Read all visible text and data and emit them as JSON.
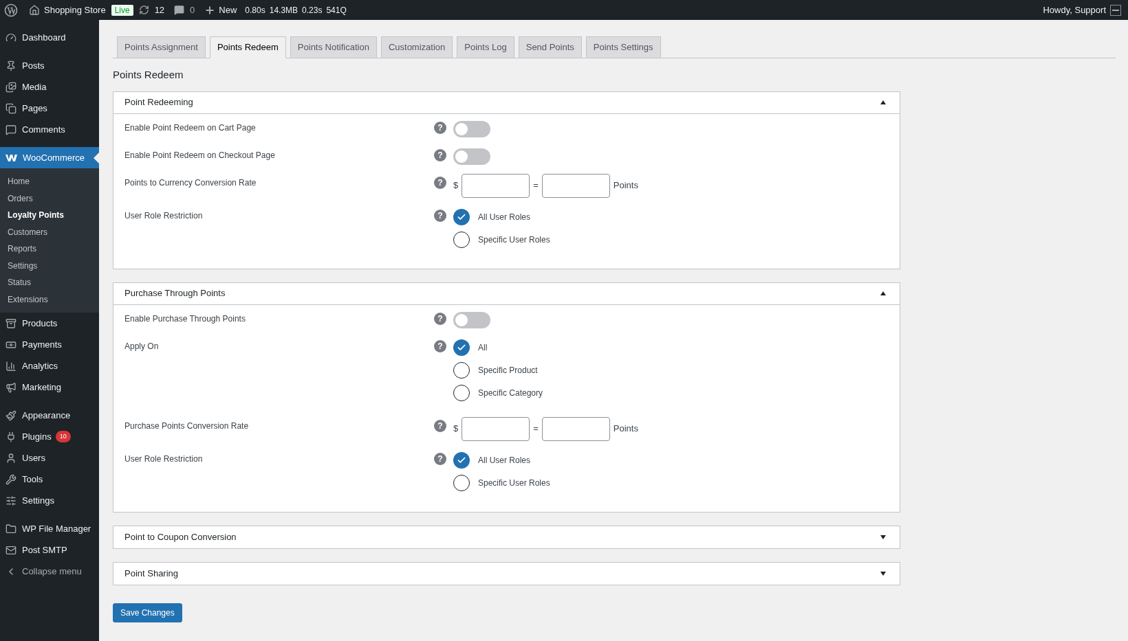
{
  "admin_bar": {
    "site": "Shopping Store",
    "live_badge": "Live",
    "updates": "12",
    "comments": "0",
    "new": "New",
    "stats": [
      "0.80s",
      "14.3MB",
      "0.23s",
      "541Q"
    ],
    "greeting": "Howdy, Support"
  },
  "sidebar": {
    "groups": [
      [
        {
          "label": "Dashboard",
          "selected": false
        }
      ],
      [
        {
          "label": "Posts",
          "selected": false
        },
        {
          "label": "Media",
          "selected": false
        },
        {
          "label": "Pages",
          "selected": false
        },
        {
          "label": "Comments",
          "selected": false
        }
      ],
      [
        {
          "label": "WooCommerce",
          "selected": true,
          "children": [
            {
              "label": "Home",
              "selected": false
            },
            {
              "label": "Orders",
              "selected": false
            },
            {
              "label": "Loyalty Points",
              "selected": true
            },
            {
              "label": "Customers",
              "selected": false
            },
            {
              "label": "Reports",
              "selected": false
            },
            {
              "label": "Settings",
              "selected": false
            },
            {
              "label": "Status",
              "selected": false
            },
            {
              "label": "Extensions",
              "selected": false
            }
          ]
        },
        {
          "label": "Products",
          "selected": false
        },
        {
          "label": "Payments",
          "selected": false
        },
        {
          "label": "Analytics",
          "selected": false
        },
        {
          "label": "Marketing",
          "selected": false
        }
      ],
      [
        {
          "label": "Appearance",
          "selected": false
        },
        {
          "label": "Plugins",
          "selected": false,
          "badge": "10"
        },
        {
          "label": "Users",
          "selected": false
        },
        {
          "label": "Tools",
          "selected": false
        },
        {
          "label": "Settings",
          "selected": false
        }
      ],
      [
        {
          "label": "WP File Manager",
          "selected": false
        },
        {
          "label": "Post SMTP",
          "selected": false
        },
        {
          "label": "Collapse menu",
          "selected": false
        }
      ]
    ]
  },
  "tabs": [
    {
      "label": "Points Assignment",
      "selected": false
    },
    {
      "label": "Points Redeem",
      "selected": true
    },
    {
      "label": "Points Notification",
      "selected": false
    },
    {
      "label": "Customization",
      "selected": false
    },
    {
      "label": "Points Log",
      "selected": false
    },
    {
      "label": "Send Points",
      "selected": false
    },
    {
      "label": "Points Settings",
      "selected": false
    }
  ],
  "page_title": "Points Redeem",
  "sections": [
    {
      "title": "Point Redeeming",
      "expanded": true,
      "fields": [
        {
          "kind": "toggle",
          "label": "Enable Point Redeem on Cart Page",
          "help": "?",
          "on": false
        },
        {
          "kind": "toggle",
          "label": "Enable Point Redeem on Checkout Page",
          "help": "?",
          "on": false
        },
        {
          "kind": "rate",
          "label": "Points to Currency Conversion Rate",
          "help": "?",
          "prefix": "$",
          "equals": "=",
          "suffix": "Points"
        },
        {
          "kind": "radio",
          "label": "User Role Restriction",
          "help": "?",
          "options": [
            {
              "label": "All User Roles",
              "selected": true
            },
            {
              "label": "Specific User Roles",
              "selected": false
            }
          ]
        }
      ]
    },
    {
      "title": "Purchase Through Points",
      "expanded": true,
      "fields": [
        {
          "kind": "toggle",
          "label": "Enable Purchase Through Points",
          "help": "?",
          "on": false
        },
        {
          "kind": "radio",
          "label": "Apply On",
          "help": "?",
          "options": [
            {
              "label": "All",
              "selected": true
            },
            {
              "label": "Specific Product",
              "selected": false
            },
            {
              "label": "Specific Category",
              "selected": false
            }
          ]
        },
        {
          "kind": "rate",
          "label": "Purchase Points Conversion Rate",
          "help": "?",
          "prefix": "$",
          "equals": "=",
          "suffix": "Points"
        },
        {
          "kind": "radio",
          "label": "User Role Restriction",
          "help": "?",
          "options": [
            {
              "label": "All User Roles",
              "selected": true
            },
            {
              "label": "Specific User Roles",
              "selected": false
            }
          ]
        }
      ]
    },
    {
      "title": "Point to Coupon Conversion",
      "expanded": false
    },
    {
      "title": "Point Sharing",
      "expanded": false
    }
  ],
  "save_button": "Save Changes"
}
